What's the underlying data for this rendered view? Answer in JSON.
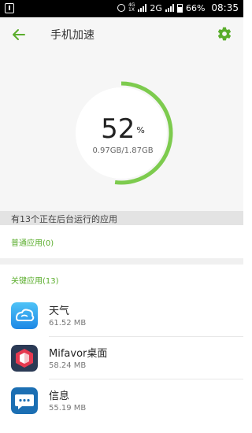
{
  "status_bar": {
    "net_top": "4G",
    "net_bottom": "1X",
    "signal_label": "2G",
    "battery": "66%",
    "time": "08:35"
  },
  "header": {
    "title": "手机加速",
    "back_icon": "back-arrow-icon",
    "settings_icon": "gear-icon",
    "accent_color": "#5aad2c"
  },
  "memory": {
    "percent": "52",
    "unit": "%",
    "usage": "0.97GB/1.87GB",
    "fraction": 0.52,
    "ring_color": "#7dcb4e"
  },
  "info": "有13个正在后台运行的应用",
  "normal_apps": {
    "label": "普通应用(0)"
  },
  "key_apps": {
    "label": "关键应用(13)",
    "items": [
      {
        "name": "天气",
        "size": "61.52 MB",
        "icon": "weather-app-icon"
      },
      {
        "name": "Mifavor桌面",
        "size": "58.24 MB",
        "icon": "launcher-app-icon"
      },
      {
        "name": "信息",
        "size": "55.19 MB",
        "icon": "messages-app-icon"
      }
    ]
  }
}
